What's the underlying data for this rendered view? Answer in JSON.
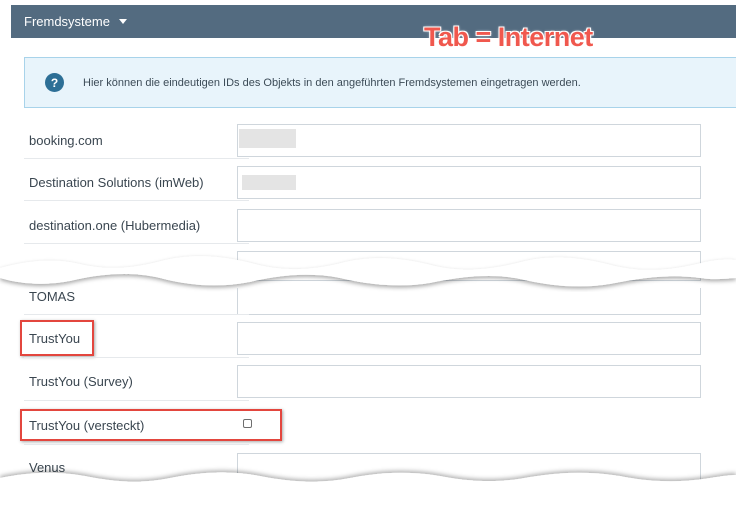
{
  "header": {
    "title": "Fremdsysteme"
  },
  "annotation": {
    "text": "Tab = Internet"
  },
  "info": {
    "icon": "question-circle-icon",
    "text": "Hier können die eindeutigen IDs des Objekts in den angeführten Fremdsystemen eingetragen werden."
  },
  "fields": {
    "booking": {
      "label": "booking.com",
      "value": ""
    },
    "destination_solutions": {
      "label": "Destination Solutions (imWeb)",
      "value": ""
    },
    "destination_one": {
      "label": "destination.one (Hubermedia)",
      "value": ""
    },
    "tomas": {
      "label": "TOMAS",
      "value": ""
    },
    "trustyou": {
      "label": "TrustYou",
      "value": ""
    },
    "trustyou_survey": {
      "label": "TrustYou (Survey)",
      "value": ""
    },
    "trustyou_hidden": {
      "label": "TrustYou (versteckt)",
      "checked": false
    },
    "venus": {
      "label": "Venus",
      "value": ""
    }
  },
  "colors": {
    "header_bg": "#536b80",
    "annotation": "#f0584e",
    "highlight": "#e3463e",
    "info_bg": "#e8f4fb",
    "info_icon": "#2d6f96"
  }
}
